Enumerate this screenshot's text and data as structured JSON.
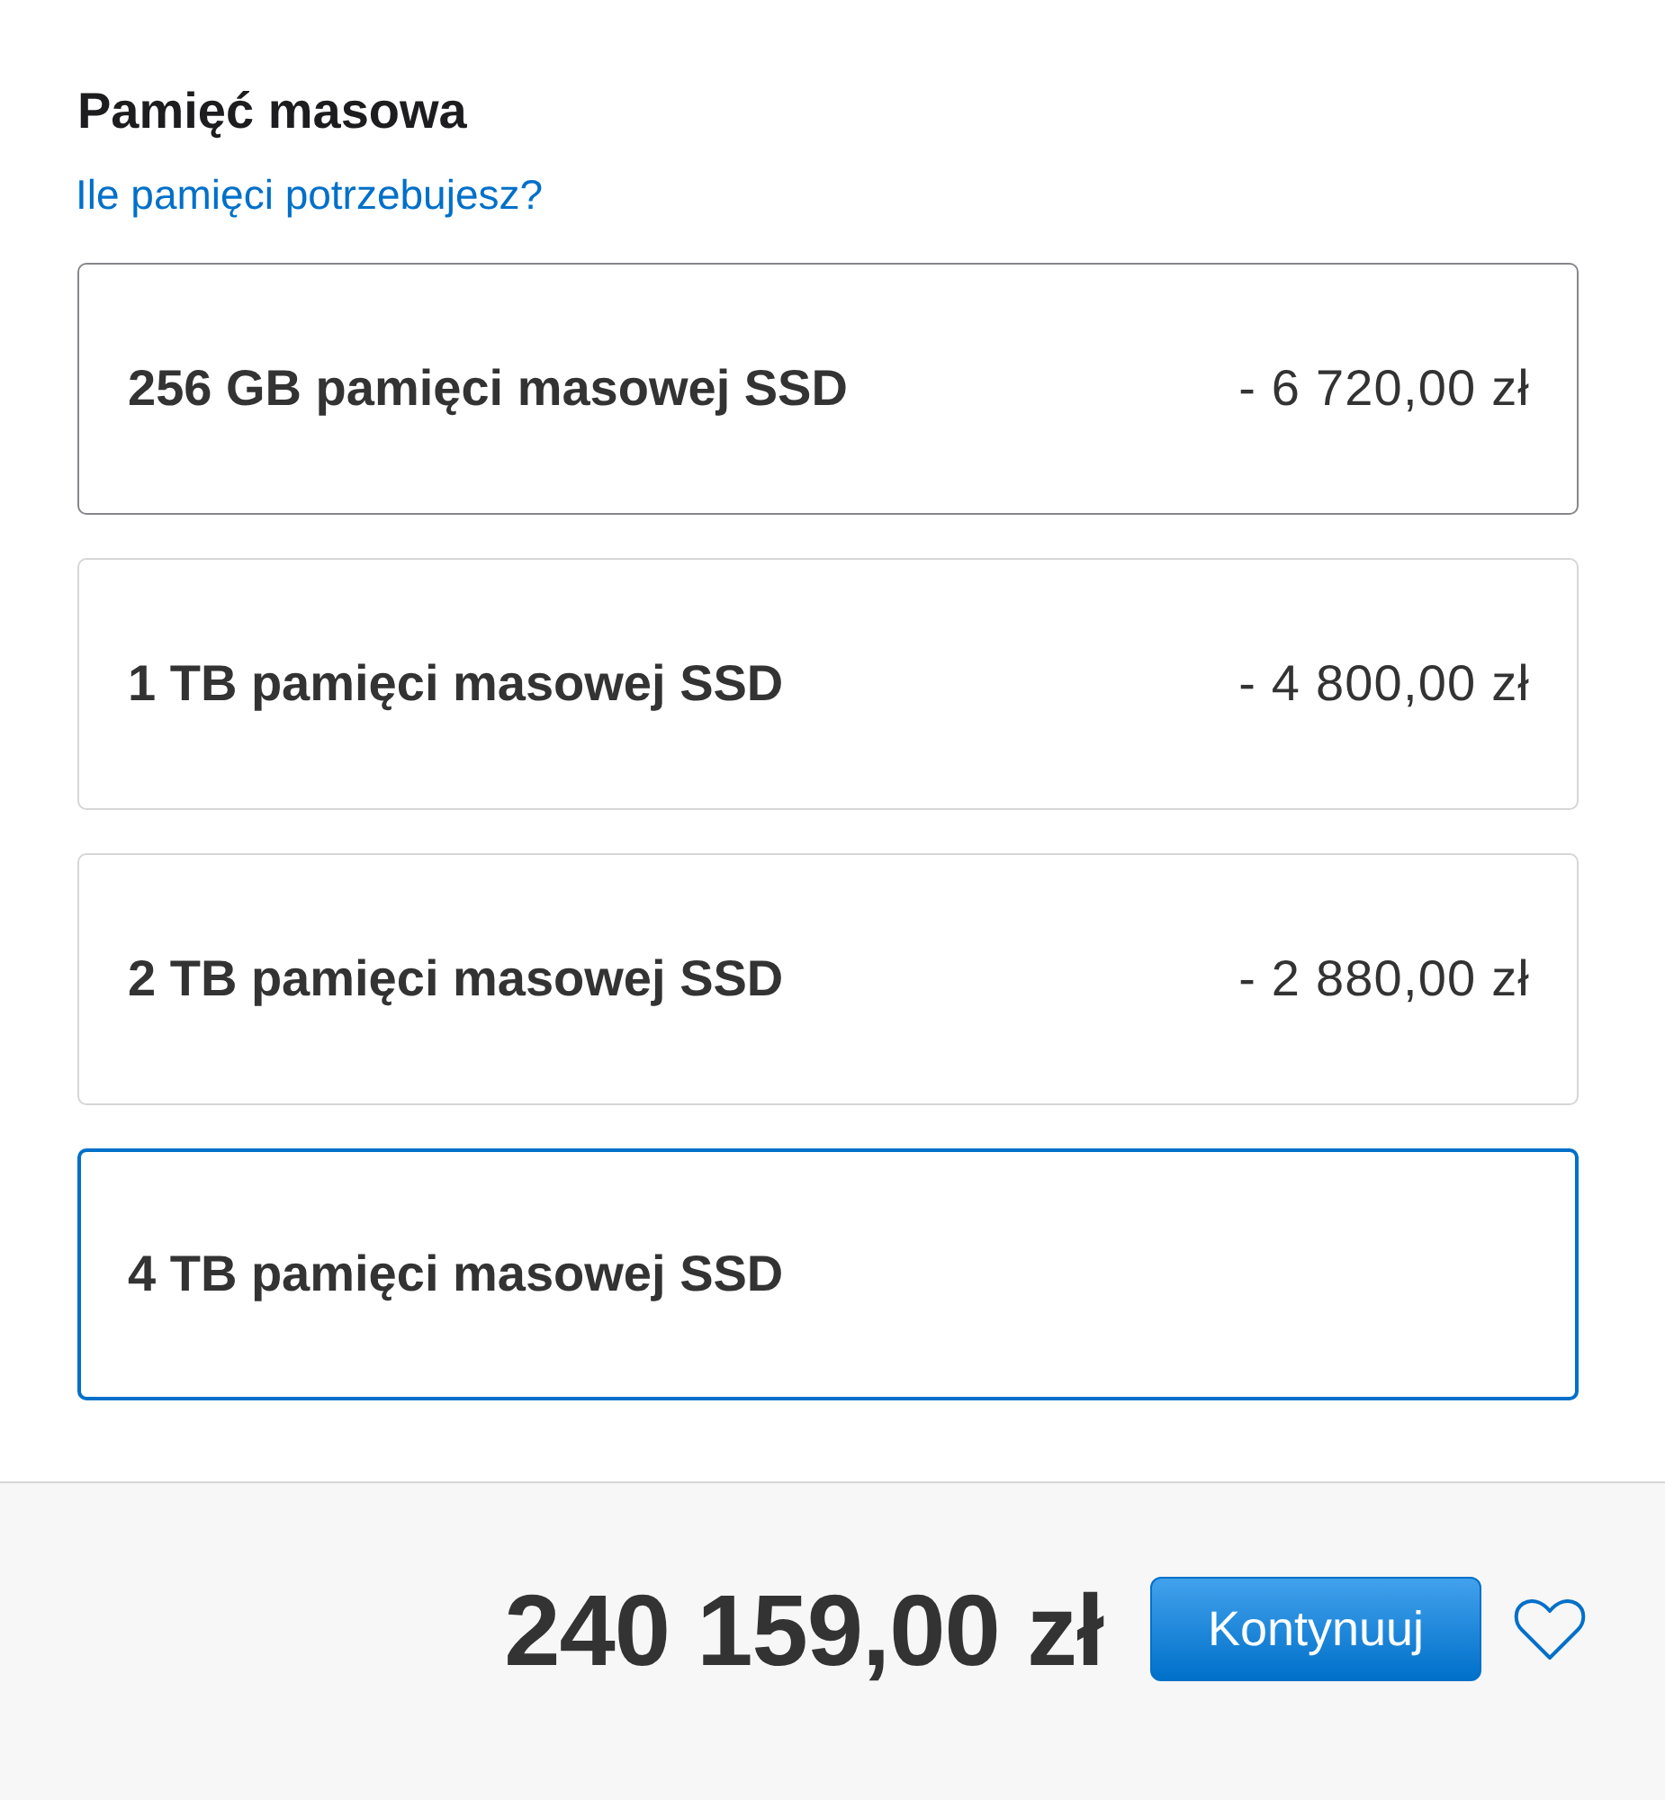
{
  "section": {
    "title": "Pamięć masowa",
    "help_link": "Ile pamięci potrzebujesz?"
  },
  "options": [
    {
      "label": "256 GB pamięci masowej SSD",
      "price_delta": "- 6 720,00 zł",
      "selected": false,
      "hovered": true
    },
    {
      "label": "1 TB pamięci masowej SSD",
      "price_delta": "- 4 800,00 zł",
      "selected": false,
      "hovered": false
    },
    {
      "label": "2 TB pamięci masowej SSD",
      "price_delta": "- 2 880,00 zł",
      "selected": false,
      "hovered": false
    },
    {
      "label": "4 TB pamięci masowej SSD",
      "selected": true,
      "hovered": false
    }
  ],
  "summary": {
    "total": "240 159,00 zł",
    "button": "Kontynuuj"
  }
}
